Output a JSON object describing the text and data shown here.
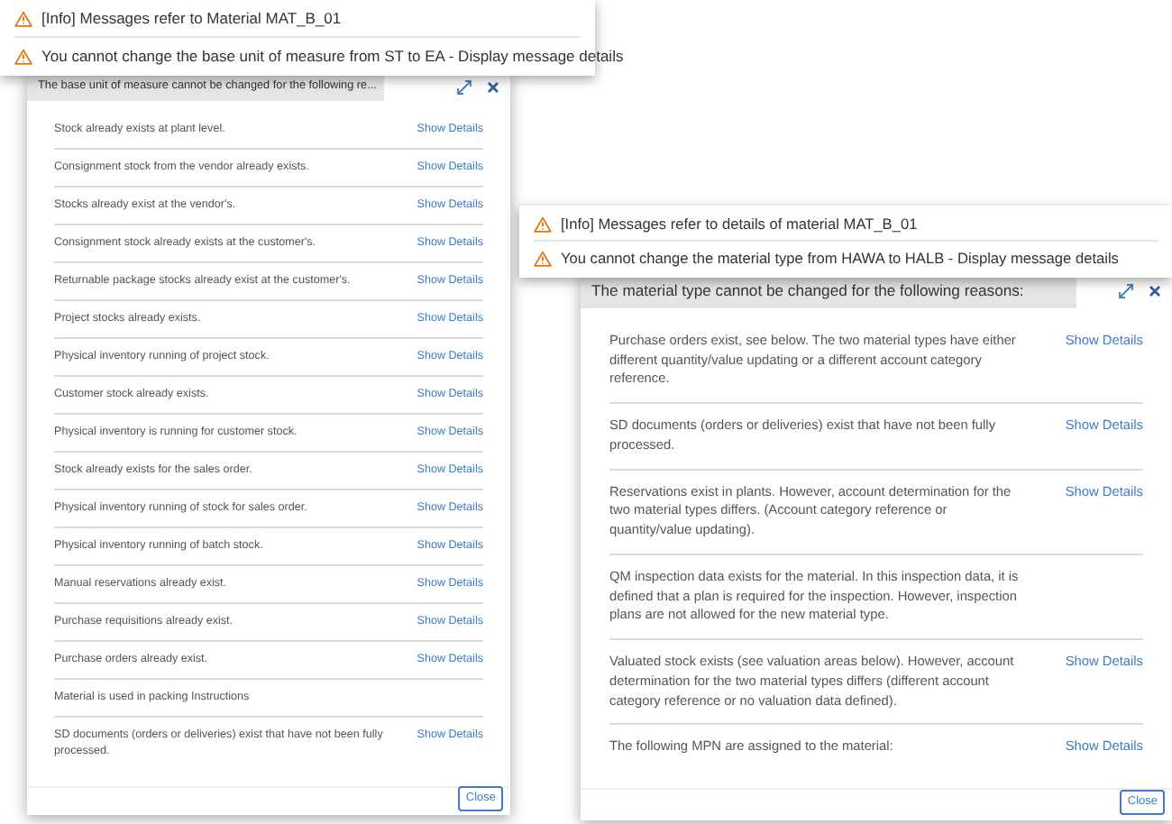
{
  "panels": [
    {
      "messages": [
        {
          "kind": "warning",
          "text": "[Info] Messages refer to Material MAT_B_01"
        },
        {
          "kind": "warning",
          "text": "You cannot change the base unit of measure from ST to EA - Display message details"
        }
      ],
      "dialog": {
        "title": "The base unit of measure cannot be changed for the following re...",
        "close": "Close",
        "reasons": [
          {
            "text": "Stock already exists at plant level.",
            "link": "Show Details"
          },
          {
            "text": "Consignment stock from the vendor already exists.",
            "link": "Show Details"
          },
          {
            "text": "Stocks already exist at the vendor's.",
            "link": "Show Details"
          },
          {
            "text": "Consignment stock already exists at the customer's.",
            "link": "Show Details"
          },
          {
            "text": "Returnable package stocks already exist at the customer's.",
            "link": "Show Details"
          },
          {
            "text": "Project stocks already exists.",
            "link": "Show Details"
          },
          {
            "text": "Physical inventory running of project stock.",
            "link": "Show Details"
          },
          {
            "text": "Customer stock already exists.",
            "link": "Show Details"
          },
          {
            "text": "Physical inventory is running for customer stock.",
            "link": "Show Details"
          },
          {
            "text": "Stock already exists for the sales order.",
            "link": "Show Details"
          },
          {
            "text": "Physical inventory running of stock for sales order.",
            "link": "Show Details"
          },
          {
            "text": "Physical inventory running of batch stock.",
            "link": "Show Details"
          },
          {
            "text": "Manual reservations already exist.",
            "link": "Show Details"
          },
          {
            "text": "Purchase requisitions already exist.",
            "link": "Show Details"
          },
          {
            "text": "Purchase orders already exist.",
            "link": "Show Details"
          },
          {
            "text": "Material is used in packing Instructions"
          },
          {
            "text": "SD documents (orders or deliveries) exist that have not been fully processed.",
            "link": "Show Details"
          }
        ]
      }
    },
    {
      "messages": [
        {
          "kind": "warning",
          "text": "[Info] Messages refer to details of material MAT_B_01"
        },
        {
          "kind": "warning",
          "text": "You cannot change the material type from HAWA to HALB - Display message details"
        }
      ],
      "dialog": {
        "title": "The material type cannot be changed for the following reasons:",
        "close": "Close",
        "reasons": [
          {
            "text": "Purchase orders exist, see below. The two material types have either different quantity/value updating or a different account category reference.",
            "link": "Show Details"
          },
          {
            "text": "SD documents (orders or deliveries) exist that have not been fully processed.",
            "link": "Show Details"
          },
          {
            "text": "Reservations exist in plants. However, account determination for the two material types differs. (Account category reference or quantity/value updating).",
            "link": "Show Details"
          },
          {
            "text": "QM inspection data exists for the material. In this inspection data, it is defined that a plan is required for the inspection. However, inspection plans are not allowed for the new material type."
          },
          {
            "text": "Valuated stock exists (see valuation areas below). However, account determination for the two material types differs (different account category reference or no valuation data defined).",
            "link": "Show Details"
          },
          {
            "text": "The following MPN are assigned to the material:",
            "link": "Show Details"
          }
        ]
      }
    }
  ]
}
